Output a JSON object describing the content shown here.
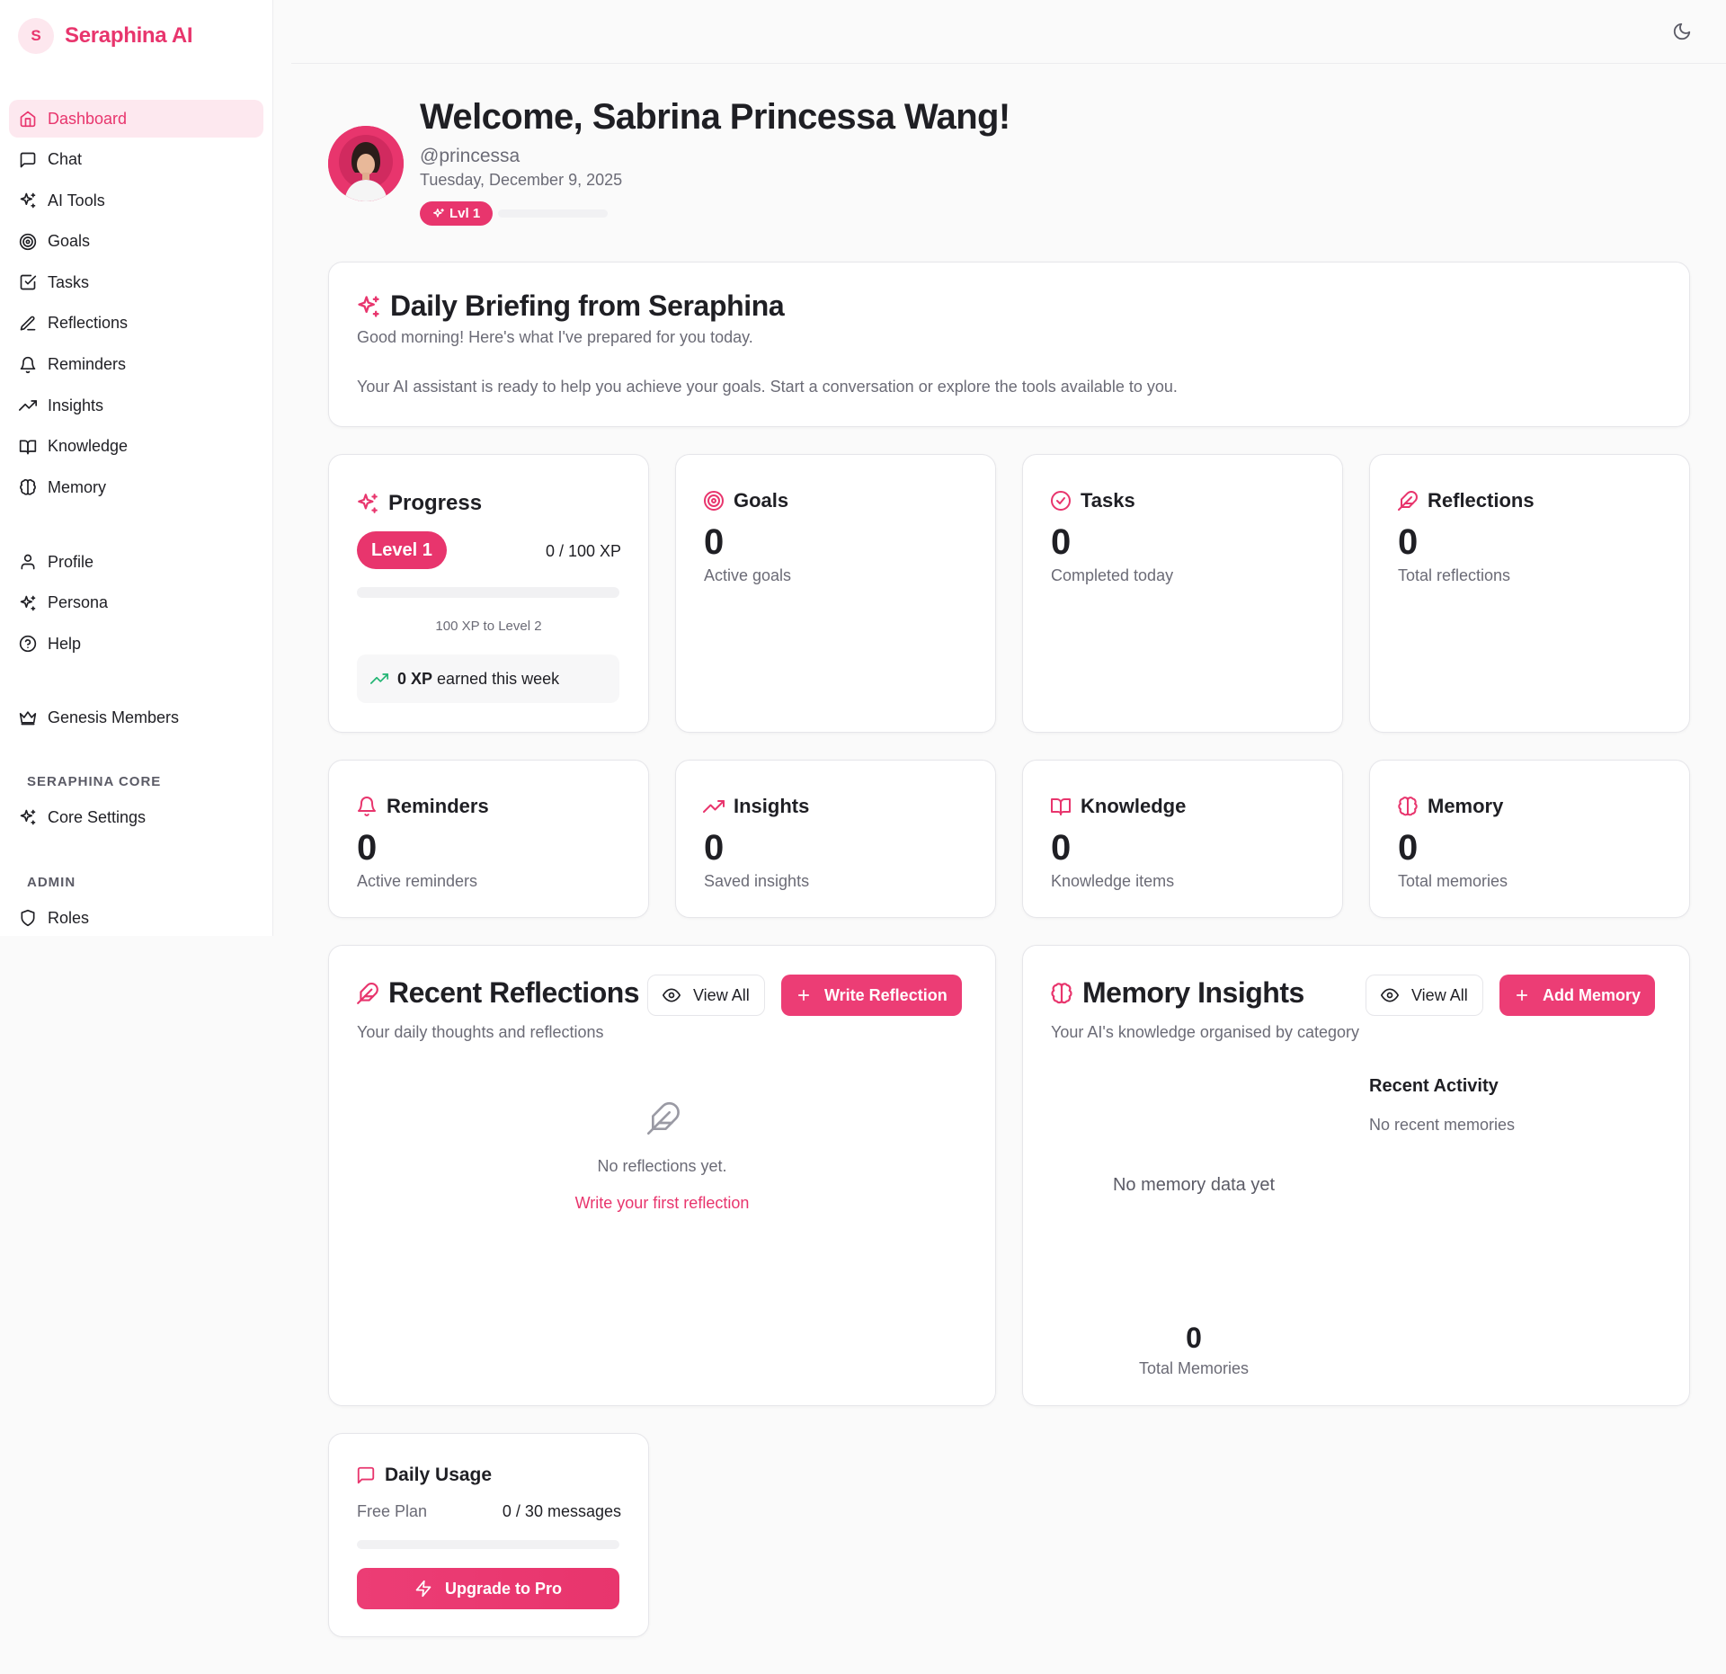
{
  "brand": {
    "initial": "S",
    "name": "Seraphina AI"
  },
  "colors": {
    "accent": "#e8356d",
    "accent_soft": "#fde8ef",
    "success": "#22b573"
  },
  "sidebar": {
    "items": [
      {
        "label": "Dashboard",
        "icon": "home-icon",
        "active": true
      },
      {
        "label": "Chat",
        "icon": "message-square-icon"
      },
      {
        "label": "AI Tools",
        "icon": "sparkles-icon"
      },
      {
        "label": "Goals",
        "icon": "target-icon"
      },
      {
        "label": "Tasks",
        "icon": "check-square-icon"
      },
      {
        "label": "Reflections",
        "icon": "pen-icon"
      },
      {
        "label": "Reminders",
        "icon": "bell-icon"
      },
      {
        "label": "Insights",
        "icon": "trending-up-icon"
      },
      {
        "label": "Knowledge",
        "icon": "book-open-icon"
      },
      {
        "label": "Memory",
        "icon": "brain-icon"
      }
    ],
    "account_items": [
      {
        "label": "Profile",
        "icon": "user-icon"
      },
      {
        "label": "Persona",
        "icon": "sparkles-icon"
      },
      {
        "label": "Help",
        "icon": "help-circle-icon"
      }
    ],
    "community_items": [
      {
        "label": "Genesis Members",
        "icon": "crown-icon"
      }
    ],
    "core_section": {
      "label": "SERAPHINA CORE",
      "items": [
        {
          "label": "Core Settings",
          "icon": "sparkles-icon"
        }
      ]
    },
    "admin_section": {
      "label": "ADMIN",
      "items": [
        {
          "label": "Roles",
          "icon": "shield-icon"
        }
      ]
    }
  },
  "topbar": {
    "theme_icon": "moon-icon"
  },
  "header": {
    "welcome": "Welcome, Sabrina Princessa Wang!",
    "handle": "@princessa",
    "date": "Tuesday, December 9, 2025",
    "level_badge": "Lvl 1",
    "level_progress": 0
  },
  "briefing": {
    "title": "Daily Briefing from Seraphina",
    "subtitle": "Good morning! Here's what I've prepared for you today.",
    "body": "Your AI assistant is ready to help you achieve your goals. Start a conversation or explore the tools available to you."
  },
  "progress": {
    "title": "Progress",
    "level_label": "Level 1",
    "xp_text": "0 / 100 XP",
    "xp_fraction": 0,
    "next_level": "100 XP to Level 2",
    "week_xp": "0 XP",
    "week_suffix": "earned this week"
  },
  "stats": {
    "goals": {
      "title": "Goals",
      "value": "0",
      "label": "Active goals"
    },
    "tasks": {
      "title": "Tasks",
      "value": "0",
      "label": "Completed today"
    },
    "reflections": {
      "title": "Reflections",
      "value": "0",
      "label": "Total reflections"
    },
    "reminders": {
      "title": "Reminders",
      "value": "0",
      "label": "Active reminders"
    },
    "insights": {
      "title": "Insights",
      "value": "0",
      "label": "Saved insights"
    },
    "knowledge": {
      "title": "Knowledge",
      "value": "0",
      "label": "Knowledge items"
    },
    "memory": {
      "title": "Memory",
      "value": "0",
      "label": "Total memories"
    }
  },
  "recent_reflections": {
    "title": "Recent Reflections",
    "subtitle": "Your daily thoughts and reflections",
    "view_all": "View All",
    "write_button": "Write Reflection",
    "empty_text": "No reflections yet.",
    "empty_link": "Write your first reflection"
  },
  "memory_insights": {
    "title": "Memory Insights",
    "subtitle": "Your AI's knowledge organised by category",
    "view_all": "View All",
    "add_button": "Add Memory",
    "recent_activity_title": "Recent Activity",
    "recent_activity_empty": "No recent memories",
    "chart_empty": "No memory data yet",
    "total_value": "0",
    "total_label": "Total Memories"
  },
  "daily_usage": {
    "title": "Daily Usage",
    "plan": "Free Plan",
    "messages": "0 / 30 messages",
    "usage_fraction": 0,
    "upgrade_button": "Upgrade to Pro"
  }
}
